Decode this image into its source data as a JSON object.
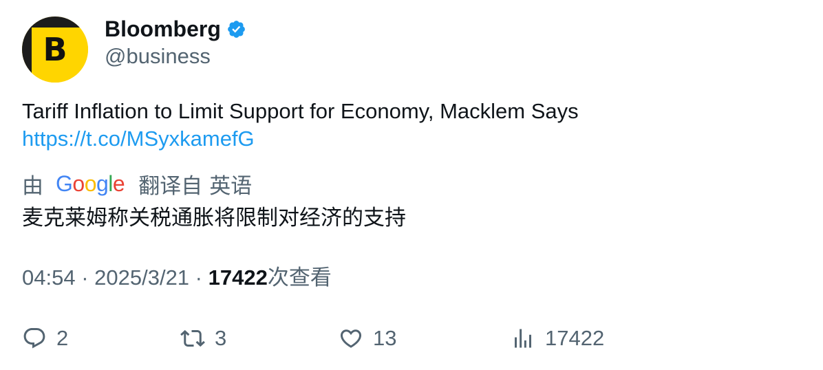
{
  "author": {
    "display_name": "Bloomberg",
    "handle": "@business",
    "avatar_letter": "B",
    "avatar_color": "#ffd500",
    "verified_color": "#1d9bf0"
  },
  "tweet": {
    "text": "Tariff Inflation to Limit Support for Economy, Macklem Says",
    "link": "https://t.co/MSyxkamefG"
  },
  "translation": {
    "by_label": "由",
    "provider_letters": [
      "G",
      "o",
      "o",
      "g",
      "l",
      "e"
    ],
    "translated_from_label": "翻译自",
    "source_language": "英语",
    "translated_text": "麦克莱姆称关税通胀将限制对经济的支持"
  },
  "meta": {
    "time": "04:54",
    "separator": " · ",
    "date": "2025/3/21",
    "views_count": "17422",
    "views_label": "次查看"
  },
  "actions": {
    "replies": "2",
    "retweets": "3",
    "likes": "13",
    "views": "17422"
  },
  "colors": {
    "text_primary": "#0f1419",
    "text_secondary": "#536471",
    "link": "#1d9bf0"
  }
}
